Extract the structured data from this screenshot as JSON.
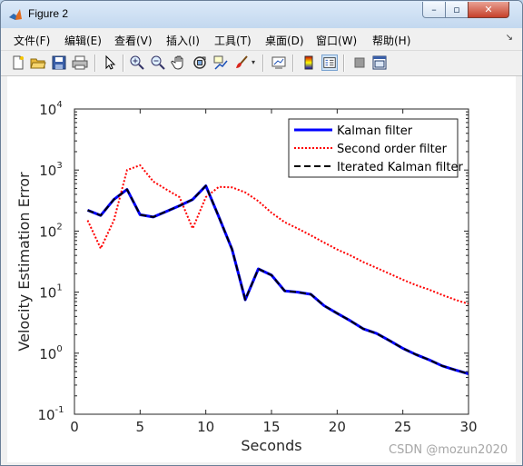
{
  "window": {
    "title": "Figure 2"
  },
  "controls": {
    "minimize": "–",
    "maximize": "▫",
    "close": "✕"
  },
  "menubar": {
    "items": [
      {
        "label": "文件(F)"
      },
      {
        "label": "编辑(E)"
      },
      {
        "label": "查看(V)"
      },
      {
        "label": "插入(I)"
      },
      {
        "label": "工具(T)"
      },
      {
        "label": "桌面(D)"
      },
      {
        "label": "窗口(W)"
      },
      {
        "label": "帮助(H)"
      }
    ],
    "overflow": "↘"
  },
  "toolbar": {
    "icons": [
      "new-figure-icon",
      "open-file-icon",
      "save-icon",
      "print-icon",
      "pointer-icon",
      "zoom-in-icon",
      "zoom-out-icon",
      "pan-hand-icon",
      "rotate-3d-icon",
      "data-cursor-icon",
      "brush-icon",
      "link-plot-icon",
      "colorbar-icon",
      "legend-icon",
      "hide-plot-tools-icon",
      "show-plot-tools-icon"
    ]
  },
  "chart_data": {
    "type": "line",
    "title": "",
    "xlabel": "Seconds",
    "ylabel": "Velocity Estimation Error",
    "xlim": [
      0,
      30
    ],
    "ylim": [
      0.1,
      10000
    ],
    "yscale": "log",
    "xticks": [
      "0",
      "5",
      "10",
      "15",
      "20",
      "25",
      "30"
    ],
    "yticks": [
      {
        "base": "10",
        "exp": "-1"
      },
      {
        "base": "10",
        "exp": "0"
      },
      {
        "base": "10",
        "exp": "1"
      },
      {
        "base": "10",
        "exp": "2"
      },
      {
        "base": "10",
        "exp": "3"
      },
      {
        "base": "10",
        "exp": "4"
      }
    ],
    "grid": false,
    "legend_position": "top-right",
    "x": [
      1,
      2,
      3,
      4,
      5,
      6,
      7,
      8,
      9,
      10,
      11,
      12,
      13,
      14,
      15,
      16,
      17,
      18,
      19,
      20,
      21,
      22,
      23,
      24,
      25,
      26,
      27,
      28,
      29,
      30
    ],
    "series": [
      {
        "name": "Kalman filter",
        "color": "#0000ff",
        "style": "solid",
        "values": [
          220,
          180,
          330,
          480,
          185,
          170,
          210,
          260,
          330,
          550,
          170,
          50,
          7.5,
          24,
          19,
          10.5,
          10,
          9.2,
          6,
          4.5,
          3.4,
          2.5,
          2.1,
          1.6,
          1.2,
          0.95,
          0.78,
          0.62,
          0.53,
          0.46
        ]
      },
      {
        "name": "Second order filter",
        "color": "#ff0000",
        "style": "dotted",
        "values": [
          150,
          52,
          150,
          1000,
          1200,
          650,
          480,
          360,
          110,
          360,
          530,
          520,
          430,
          310,
          200,
          140,
          110,
          85,
          65,
          50,
          40,
          31,
          25,
          20,
          16,
          13,
          11,
          9,
          7.5,
          6.4
        ]
      },
      {
        "name": "Iterated Kalman filter",
        "color": "#000000",
        "style": "dashed",
        "values": [
          220,
          180,
          330,
          480,
          185,
          170,
          210,
          260,
          330,
          550,
          170,
          50,
          7.5,
          24,
          19,
          10.5,
          10,
          9.2,
          6,
          4.5,
          3.4,
          2.5,
          2.1,
          1.6,
          1.2,
          0.95,
          0.78,
          0.62,
          0.53,
          0.46
        ]
      }
    ]
  },
  "watermark": "CSDN @mozun2020"
}
